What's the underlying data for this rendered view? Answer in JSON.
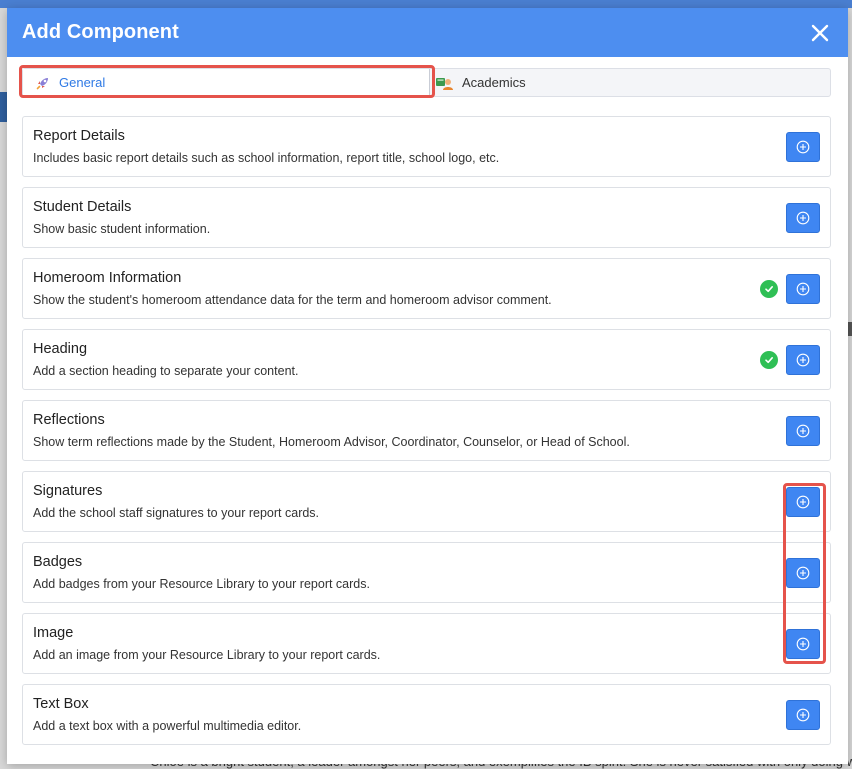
{
  "modal": {
    "title": "Add Component",
    "close_icon": "close-icon"
  },
  "tabs": [
    {
      "label": "General",
      "icon": "rocket-icon",
      "active": true
    },
    {
      "label": "Academics",
      "icon": "student-icon",
      "active": false
    }
  ],
  "components": [
    {
      "title": "Report Details",
      "description": "Includes basic report details such as school information, report title, school logo, etc.",
      "added": false
    },
    {
      "title": "Student Details",
      "description": "Show basic student information.",
      "added": false
    },
    {
      "title": "Homeroom Information",
      "description": "Show the student's homeroom attendance data for the term and homeroom advisor comment.",
      "added": true
    },
    {
      "title": "Heading",
      "description": "Add a section heading to separate your content.",
      "added": true
    },
    {
      "title": "Reflections",
      "description": "Show term reflections made by the Student, Homeroom Advisor, Coordinator, Counselor, or Head of School.",
      "added": false
    },
    {
      "title": "Signatures",
      "description": "Add the school staff signatures to your report cards.",
      "added": false
    },
    {
      "title": "Badges",
      "description": "Add badges from your Resource Library to your report cards.",
      "added": false
    },
    {
      "title": "Image",
      "description": "Add an image from your Resource Library to your report cards.",
      "added": false
    },
    {
      "title": "Text Box",
      "description": "Add a text box with a powerful multimedia editor.",
      "added": false
    }
  ],
  "background": {
    "partial_text": "Chloe is a bright student, a leader amongst her peers, and exemplifies the IB spirit. She is never satisfied with only doing wo"
  },
  "colors": {
    "header": "#4d8ef0",
    "button": "#3f86f2",
    "check": "#2fbf55",
    "highlight": "#e5534b",
    "active_tab_text": "#2f7ae5"
  }
}
